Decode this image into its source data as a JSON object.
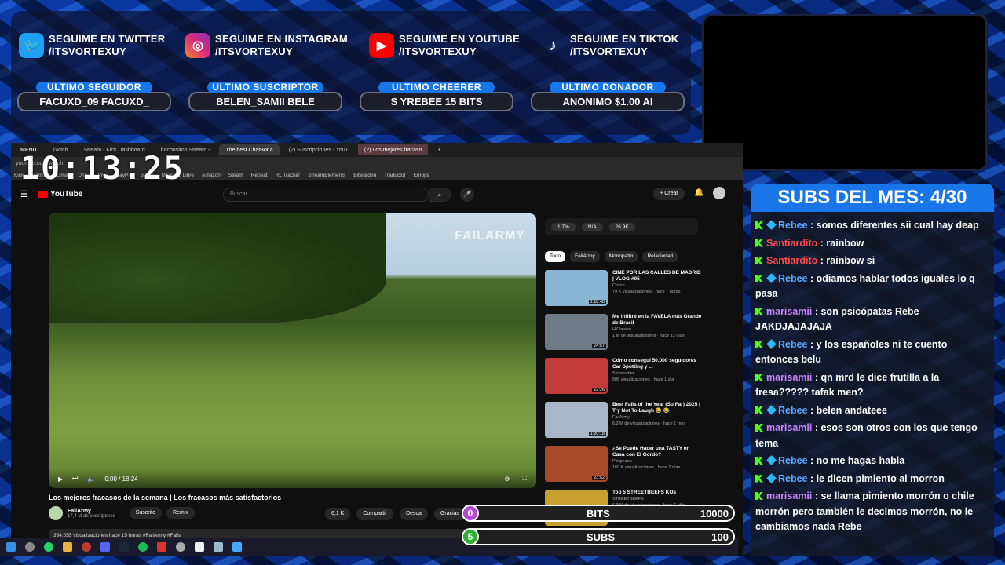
{
  "socials": [
    {
      "icon": "twitter-icon",
      "line1": "SEGUIME EN TWITTER",
      "line2": "/ITSVORTEXUY",
      "color": "#1da1f2"
    },
    {
      "icon": "instagram-icon",
      "line1": "SEGUIME EN INSTAGRAM",
      "line2": "/ITSVORTEXUY",
      "color": "#d6249f"
    },
    {
      "icon": "youtube-icon",
      "line1": "SEGUIME EN YOUTUBE",
      "line2": "/ITSVORTEXUY",
      "color": "#ff0000"
    },
    {
      "icon": "tiktok-icon",
      "line1": "SEGUIME EN TIKTOK",
      "line2": "/ITSVORTEXUY",
      "color": "#000000"
    }
  ],
  "stats": [
    {
      "label": "ULTIMO SEGUIDOR",
      "value": "FACUXD_09        FACUXD_"
    },
    {
      "label": "ULTIMO SUSCRIPTOR",
      "value": "BELEN_SAMII        BELE"
    },
    {
      "label": "ULTIMO CHEERER",
      "value": "S       YREBEE 15 BITS"
    },
    {
      "label": "ULTIMO DONADOR",
      "value": "ANONIMO $1.00        AI"
    }
  ],
  "clock": "10:13:25",
  "browser": {
    "tabs": [
      "MENÚ",
      "Twitch",
      "Stream - Kick Dashboard",
      "baconsitoo Stream -",
      "The best ChatBot a",
      "(2) Suscripciones - YouT",
      "(2) Los mejores fracaso"
    ],
    "address": "youtube.com/watch",
    "bookmarks": [
      "Kick",
      "Hotmail",
      "Gmail",
      "Drive",
      "Prex",
      "PayPal",
      "Stripe",
      "Mercado Libre",
      "Amazon",
      "Steam",
      "Repeat",
      "RL Tracker",
      "StreamElements",
      "Bitwarden",
      "Traductor",
      "Emojis"
    ]
  },
  "youtube": {
    "logo": "YouTube",
    "search_placeholder": "Buscar",
    "create_label": "+ Crear",
    "watermark": "FAILARMY",
    "time": "0:00 / 18:24",
    "title": "Los mejores fracasos de la semana | Los fracasos más satisfactorios",
    "channel": "FailArmy",
    "subs": "17,4 M de suscriptores",
    "subscribed": "Suscrito",
    "remix": "Remix",
    "likes": "6,1 K",
    "share": "Compartir",
    "download": "Desca",
    "thanks": "Gracias",
    "desc": "364.055 visualizaciones  hace 15 horas  #FailArmy #Fails",
    "side_stats": [
      "1.7%",
      "N/A",
      "26.9K"
    ],
    "chips": [
      "Todo",
      "FailArmy",
      "Monopatín",
      "Relacionad"
    ],
    "recs": [
      {
        "title": "CINE POR LAS CALLES DE MADRID | VLOG #05",
        "channel": "Coscu",
        "meta": "79 K visualizaciones · hace 7 horas",
        "dur": "1:18:48",
        "color": "#8ab6d6"
      },
      {
        "title": "Me Infiltré en la FAVELA más Grande de Brasil",
        "channel": "HiClavero",
        "meta": "1 M de visualizaciones · hace 12 días",
        "dur": "24:57",
        "color": "#6d7a88"
      },
      {
        "title": "Cómo conseguí 50.000 seguidores Car Spotting y ...",
        "channel": "Skipdasher",
        "meta": "508 visualizaciones · hace 1 día",
        "dur": "22:26",
        "color": "#c23b3b"
      },
      {
        "title": "Best Fails of the Year (So Far) 2025 | Try Not To Laugh 😂 😂",
        "channel": "FailArmy",
        "meta": "6,2 M de visualizaciones · hace 1 mes",
        "dur": "1:20:18",
        "color": "#a7b7c8"
      },
      {
        "title": "¿Se Puede Hacer una TASTY en Casa con El Gordo?",
        "channel": "Pimpeano",
        "meta": "169 K visualizaciones · hace 2 días",
        "dur": "23:52",
        "color": "#a64a2a"
      },
      {
        "title": "Top 5 STREETBEEFS KOs",
        "channel": "STREETBEEFS",
        "meta": "6,9 M de visualizaciones · hace 1 año",
        "dur": "",
        "color": "#c8a030"
      }
    ]
  },
  "goals": [
    {
      "circle": "0",
      "label": "BITS",
      "value": "10000",
      "color": "#b14bd6"
    },
    {
      "circle": "5",
      "label": "SUBS",
      "value": "100",
      "color": "#2fae2f"
    }
  ],
  "subs_title": "SUBS DEL MES: 4/30",
  "chat": [
    {
      "user": "Rebee",
      "color": "u-blue",
      "gem": true,
      "text": "somos diferentes sii cual hay deap"
    },
    {
      "user": "Santiardito",
      "color": "u-red",
      "gem": false,
      "text": "rainbow"
    },
    {
      "user": "Santiardito",
      "color": "u-red",
      "gem": false,
      "text": "rainbow si"
    },
    {
      "user": "Rebee",
      "color": "u-blue",
      "gem": true,
      "text": "odiamos hablar todos iguales lo q pasa"
    },
    {
      "user": "marisamii",
      "color": "u-purple",
      "gem": false,
      "text": "son psicópatas Rebe JAKDJAJAJAJA"
    },
    {
      "user": "Rebee",
      "color": "u-blue",
      "gem": true,
      "text": "y los españoles ni te cuento entonces belu"
    },
    {
      "user": "marisamii",
      "color": "u-purple",
      "gem": false,
      "text": "qn mrd le dice frutilla a la fresa????? tafak men?"
    },
    {
      "user": "Rebee",
      "color": "u-blue",
      "gem": true,
      "text": "belen andateee"
    },
    {
      "user": "marisamii",
      "color": "u-purple",
      "gem": false,
      "text": "esos son otros con los que tengo tema"
    },
    {
      "user": "Rebee",
      "color": "u-blue",
      "gem": true,
      "text": "no me hagas habla"
    },
    {
      "user": "Rebee",
      "color": "u-blue",
      "gem": true,
      "text": "le dicen pimiento al morron"
    },
    {
      "user": "marisamii",
      "color": "u-purple",
      "gem": false,
      "text": "se llama pimiento morrón o chile morrón pero también le decimos morrón, no le cambiamos nada Rebe"
    }
  ]
}
